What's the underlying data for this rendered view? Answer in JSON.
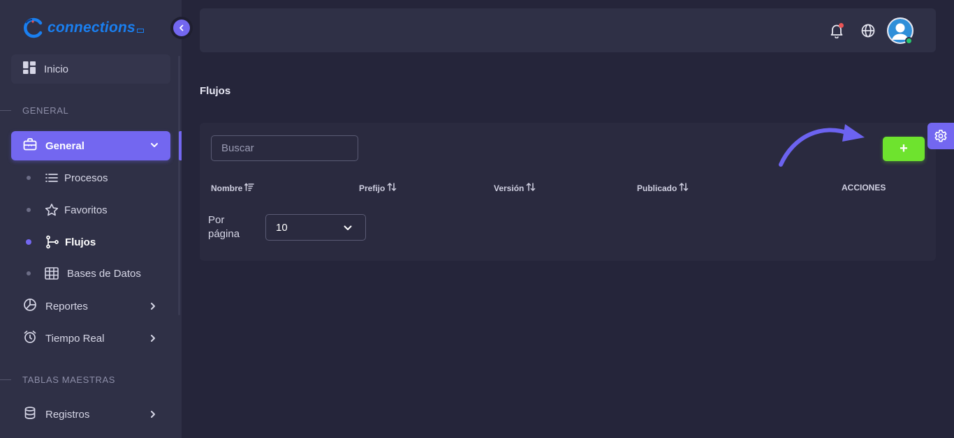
{
  "app": {
    "logo_text": "connections"
  },
  "sidebar": {
    "inicio": "Inicio",
    "section_general": "GENERAL",
    "general": "General",
    "sub_items": [
      {
        "label": "Procesos",
        "icon": "list-icon"
      },
      {
        "label": "Favoritos",
        "icon": "star-icon"
      },
      {
        "label": "Flujos",
        "icon": "flow-branch-icon",
        "active": true
      },
      {
        "label": "Bases de Datos",
        "icon": "table-icon"
      }
    ],
    "reportes": "Reportes",
    "tiempo_real": "Tiempo Real",
    "section_tablas": "TABLAS MAESTRAS",
    "registros": "Registros"
  },
  "page": {
    "title": "Flujos"
  },
  "search": {
    "placeholder": "Buscar"
  },
  "add_button": {
    "label": "+"
  },
  "table": {
    "columns": [
      "Nombre",
      "Prefijo",
      "Versión",
      "Publicado",
      "ACCIONES"
    ]
  },
  "pagination": {
    "per_page_label_1": "Por",
    "per_page_label_2": "página",
    "per_page_value": "10"
  },
  "colors": {
    "accent": "#7367f0",
    "add_button": "#6ee32e",
    "sidebar_bg": "#2f3046",
    "page_bg": "#25253a",
    "online_status": "#28c76f",
    "notification": "#ea5455"
  }
}
